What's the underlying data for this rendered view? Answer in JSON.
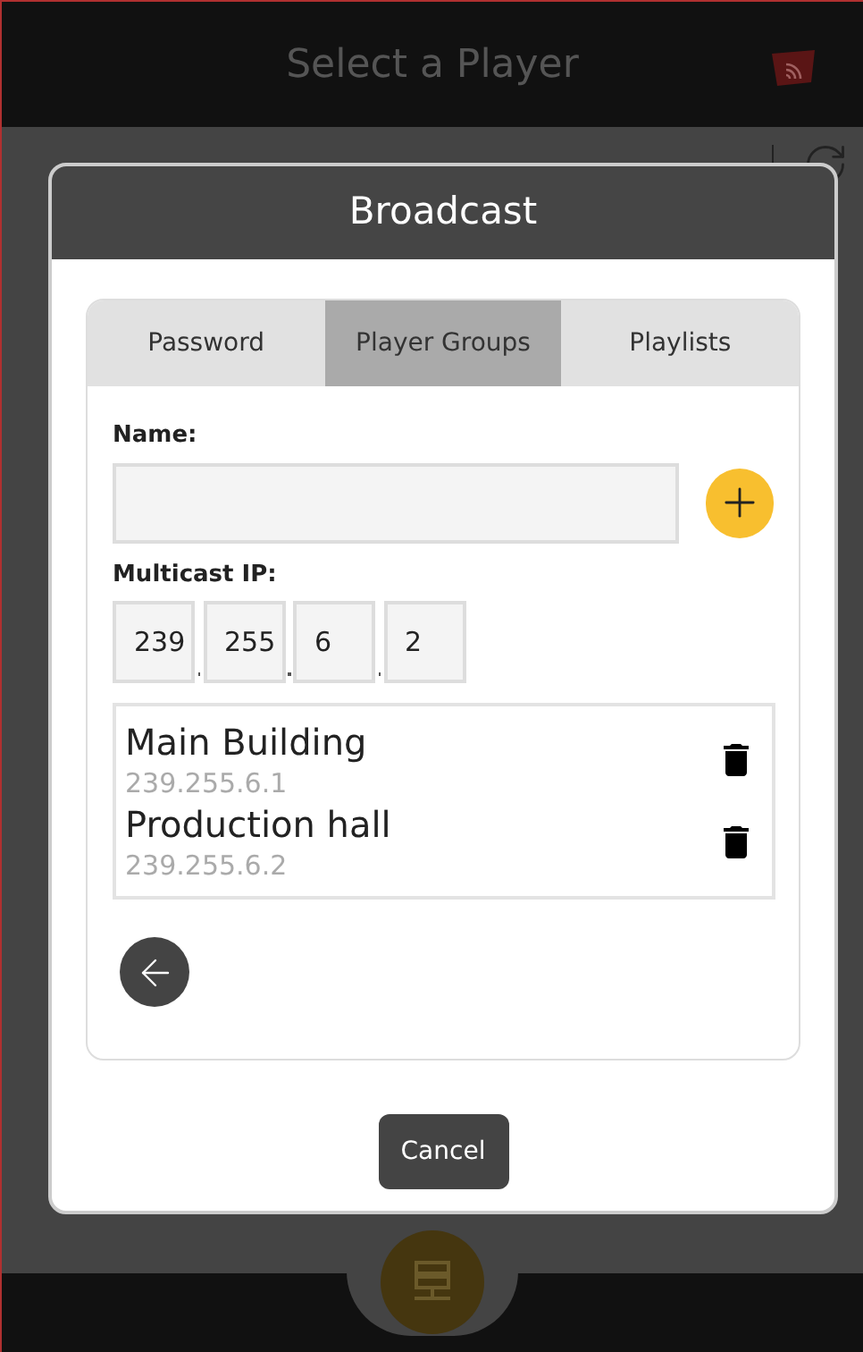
{
  "header": {
    "title": "Select a Player"
  },
  "dialog": {
    "title": "Broadcast",
    "tabs": [
      {
        "label": "Password",
        "selected": false
      },
      {
        "label": "Player Groups",
        "selected": true
      },
      {
        "label": "Playlists",
        "selected": false
      }
    ],
    "name_label": "Name:",
    "ip_label": "Multicast IP:",
    "ip_octets": [
      "239",
      "255",
      "6",
      "2"
    ],
    "groups": [
      {
        "name": "Main Building",
        "ip": "239.255.6.1"
      },
      {
        "name": "Production hall",
        "ip": "239.255.6.2"
      }
    ],
    "cancel": "Cancel"
  }
}
